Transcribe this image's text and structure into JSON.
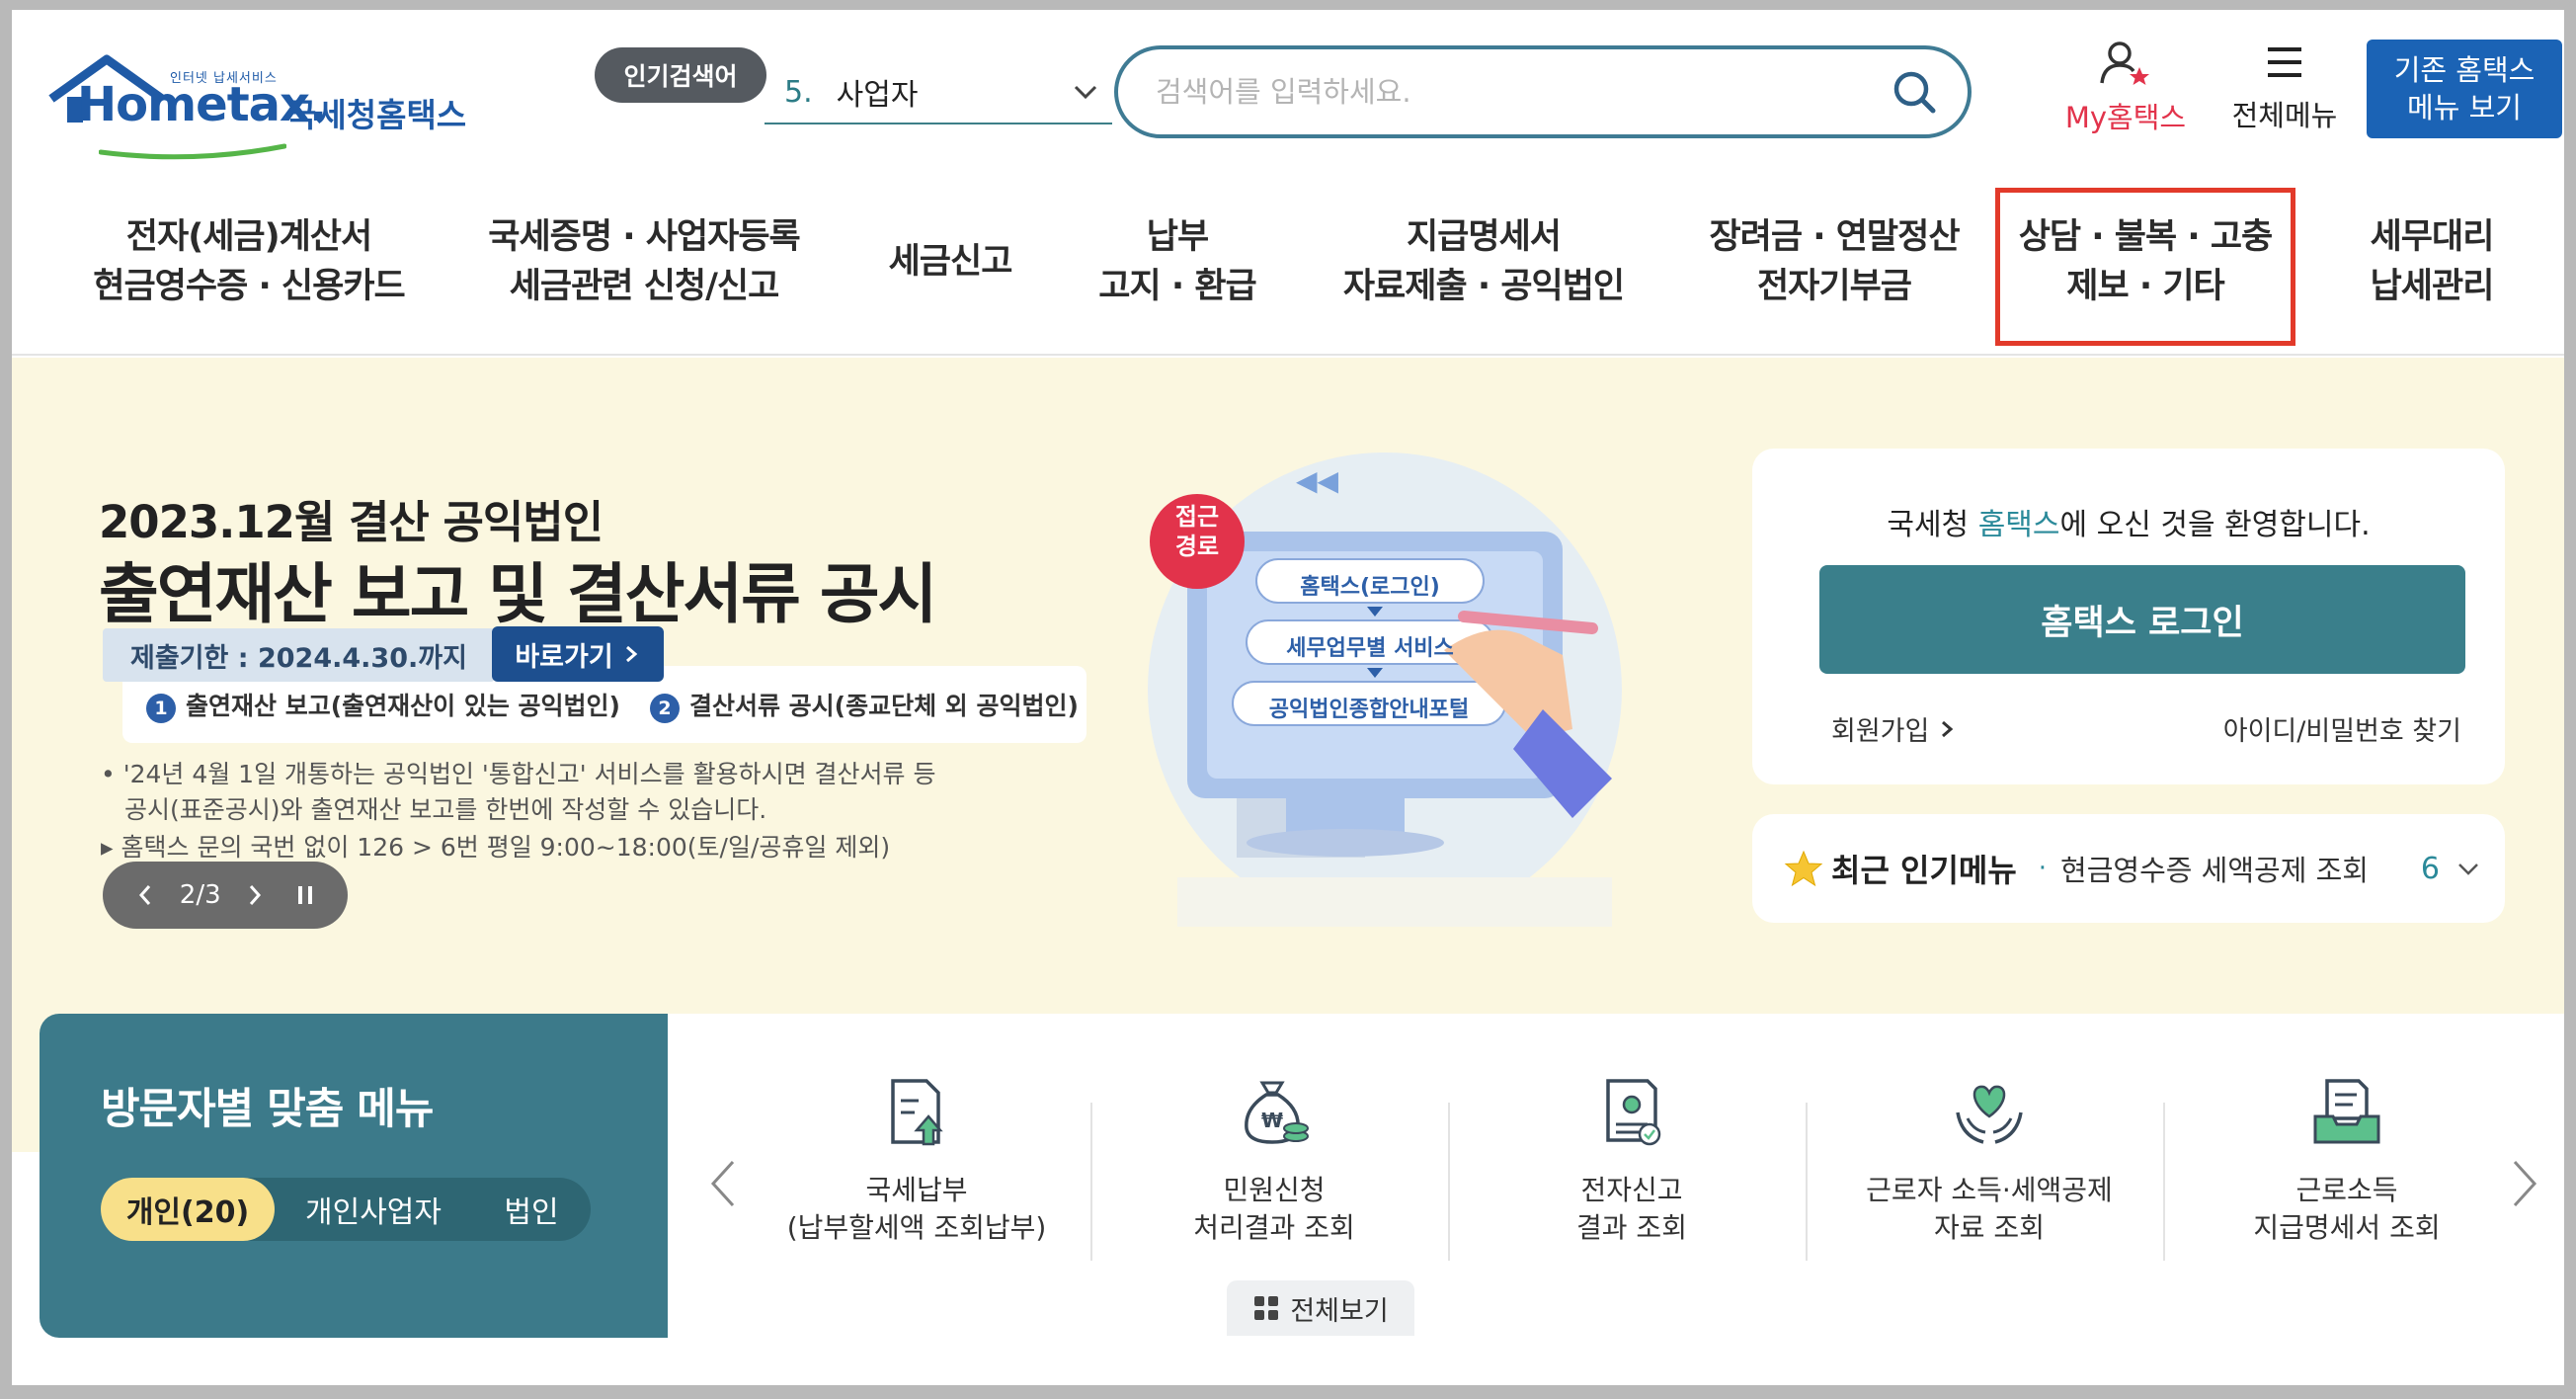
{
  "header": {
    "logo": {
      "tagline": "인터넷 납세서비스",
      "wordmark": "Hometax.",
      "name_kr": "국세청홈택스"
    },
    "popular_search": {
      "badge": "인기검색어",
      "rank": "5.",
      "term": "사업자"
    },
    "search": {
      "placeholder": "검색어를 입력하세요.",
      "value": ""
    },
    "my_hometax": "My홈택스",
    "all_menu": "전체메뉴",
    "legacy_button": {
      "line1": "기존 홈택스",
      "line2": "메뉴 보기"
    }
  },
  "gnb": [
    {
      "line1": "전자(세금)계산서",
      "line2": "현금영수증 · 신용카드"
    },
    {
      "line1": "국세증명 · 사업자등록",
      "line2": "세금관련 신청/신고"
    },
    {
      "line1": "세금신고",
      "line2": ""
    },
    {
      "line1": "납부",
      "line2": "고지 · 환급"
    },
    {
      "line1": "지급명세서",
      "line2": "자료제출 · 공익법인"
    },
    {
      "line1": "장려금 · 연말정산",
      "line2": "전자기부금"
    },
    {
      "line1": "상담 · 불복 · 고충",
      "line2": "제보 · 기타"
    },
    {
      "line1": "세무대리",
      "line2": "납세관리"
    }
  ],
  "banner": {
    "subtitle": "2023.12월 결산 공익법인",
    "title": "출연재산 보고 및 결산서류 공시",
    "deadline": "제출기한 : 2024.4.30.까지",
    "goto_label": "바로가기",
    "step1_num": "1",
    "step1": "출연재산 보고(출연재산이 있는 공익법인)",
    "step2_num": "2",
    "step2": "결산서류 공시(종교단체 외 공익법인)",
    "note1_line1": "• '24년 4월 1일 개통하는 공익법인 '통합신고' 서비스를 활용하시면 결산서류 등",
    "note1_line2": "공시(표준공시)와 출연재산 보고를 한번에 작성할 수 있습니다.",
    "note2": "▸ 홈택스 문의 국번 없이 126 > 6번 평일 9:00~18:00(토/일/공휴일 제외)",
    "pager": "2/3",
    "illustration": {
      "badge_line1": "접근",
      "badge_line2": "경로",
      "path1": "홈택스(로그인)",
      "path2": "세무업무별 서비스",
      "path3": "공익법인종합안내포털"
    }
  },
  "login": {
    "welcome_prefix": "국세청 ",
    "welcome_brand": "홈택스",
    "welcome_suffix": "에 오신 것을 환영합니다.",
    "login_button": "홈택스 로그인",
    "signup": "회원가입",
    "find_account": "아이디/비밀번호 찾기"
  },
  "recent_popular": {
    "label": "최근 인기메뉴",
    "item": "현금영수증 세액공제 조회",
    "rank": "6"
  },
  "visitor_menu": {
    "title": "방문자별 맞춤 메뉴",
    "tabs": [
      "개인(20)",
      "개인사업자",
      "법인"
    ]
  },
  "quick_menu": [
    {
      "icon": "tax-payment-icon",
      "line1": "국세납부",
      "line2": "(납부할세액 조회납부)"
    },
    {
      "icon": "money-bag-icon",
      "line1": "민원신청",
      "line2": "처리결과 조회"
    },
    {
      "icon": "e-filing-icon",
      "line1": "전자신고",
      "line2": "결과 조회"
    },
    {
      "icon": "heart-hands-icon",
      "line1": "근로자 소득·세액공제",
      "line2": "자료 조회"
    },
    {
      "icon": "document-tray-icon",
      "line1": "근로소득",
      "line2": "지급명세서 조회"
    }
  ],
  "view_all": "전체보기",
  "colors": {
    "brand_blue": "#1f5aa6",
    "teal": "#3a7f8b",
    "highlight_red": "#e23a2a",
    "banner_bg": "#fbf7e0",
    "active_tab": "#f8e08a"
  }
}
